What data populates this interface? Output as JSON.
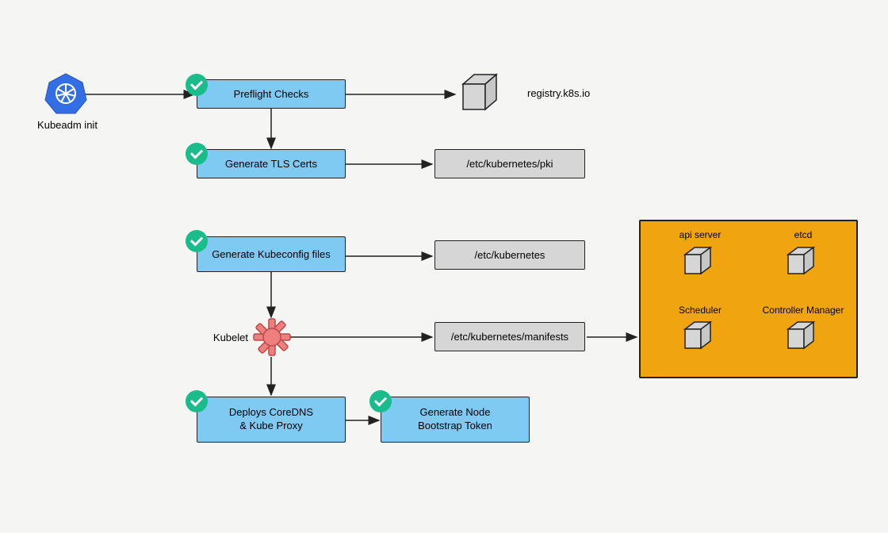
{
  "diagram": {
    "start": {
      "label": "Kubeadm init"
    },
    "steps": {
      "preflight": "Preflight Checks",
      "tls": "Generate TLS Certs",
      "kubeconfig": "Generate Kubeconfig files",
      "kubelet": "Kubelet",
      "coredns_line1": "Deploys CoreDNS",
      "coredns_line2": "& Kube Proxy",
      "bootstrap_line1": "Generate Node",
      "bootstrap_line2": "Bootstrap Token"
    },
    "outputs": {
      "registry": "registry.k8s.io",
      "pki": "/etc/kubernetes/pki",
      "kube_dir": "/etc/kubernetes",
      "manifests": "/etc/kubernetes/manifests"
    },
    "control_plane": {
      "api_server": "api server",
      "etcd": "etcd",
      "scheduler": "Scheduler",
      "controller": "Controller Manager"
    }
  }
}
